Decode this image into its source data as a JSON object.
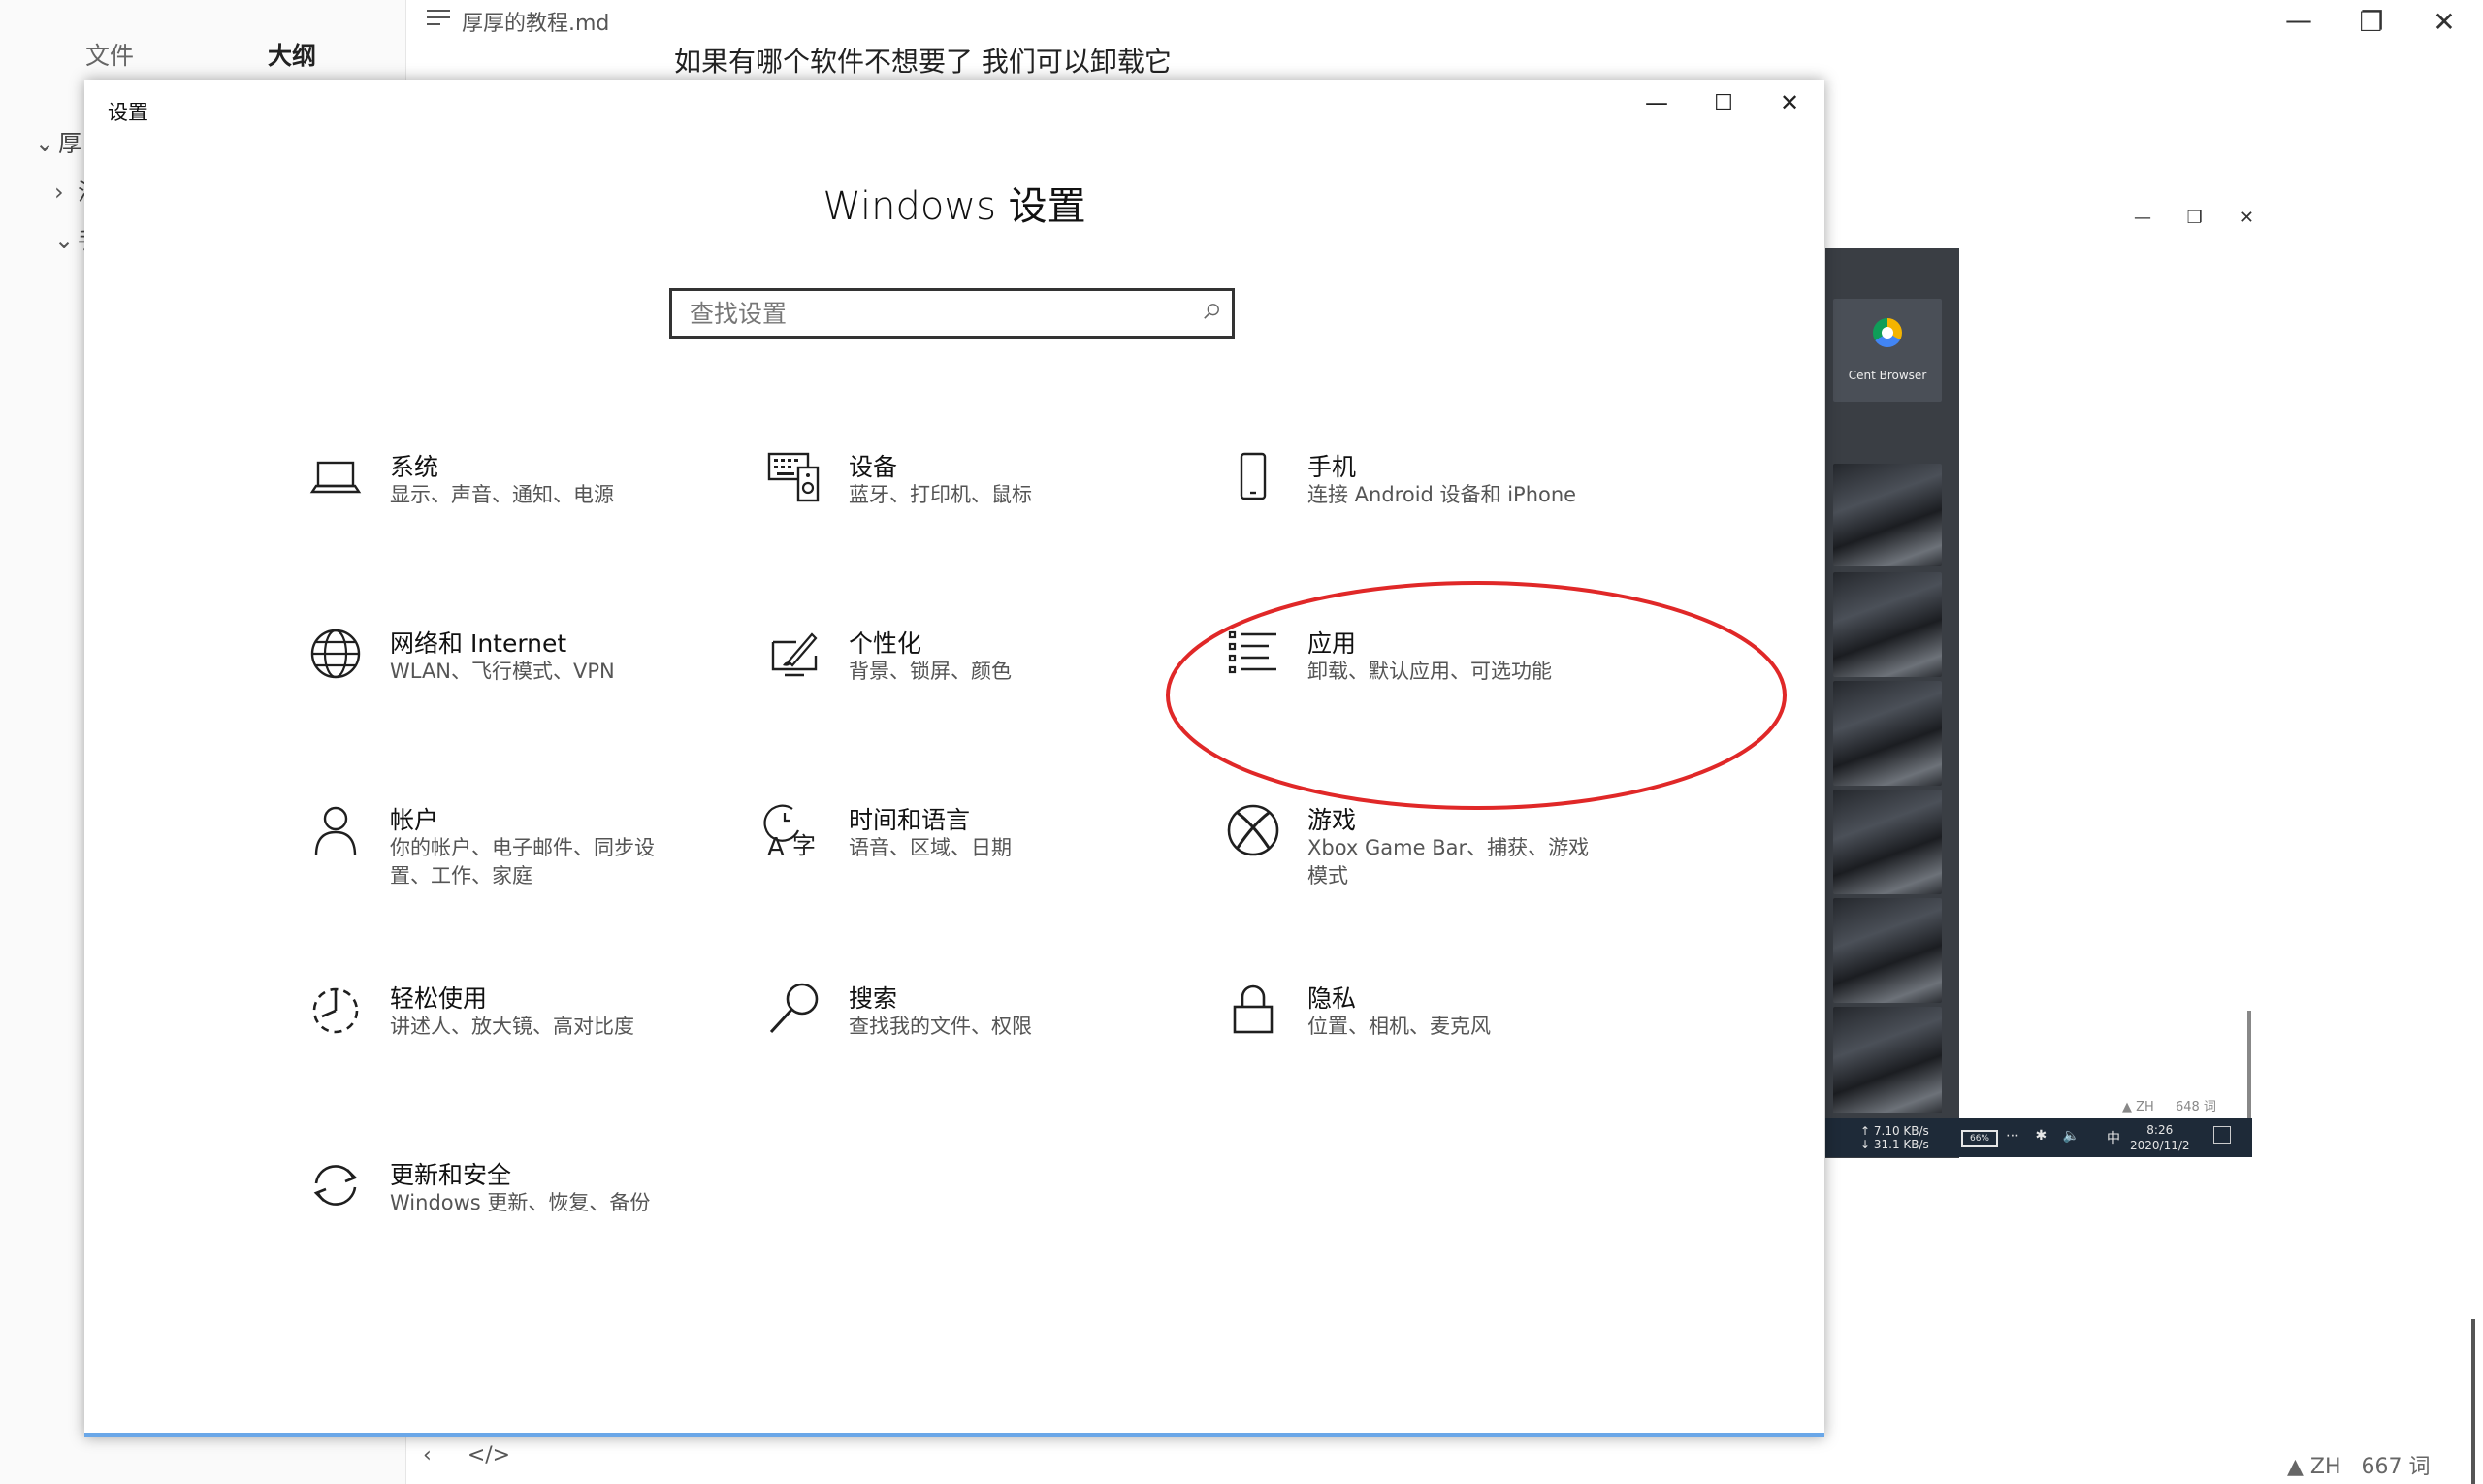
{
  "typora": {
    "tab_file": "文件",
    "tab_outline": "大纲",
    "outline_rows": [
      {
        "chevron": "⌄",
        "text": "厚"
      },
      {
        "chevron": "›",
        "text": "注"
      },
      {
        "chevron": "⌄",
        "text": "手"
      }
    ],
    "file_title": "厚厚的教程.md",
    "doc_line": "如果有哪个软件不想要了  我们可以卸载它",
    "min": "—",
    "max": "❐",
    "close": "✕",
    "bottom_left": [
      "‹",
      "</>"
    ],
    "status_warn": "▲ ZH",
    "word_count": "667 词"
  },
  "mirror": {
    "controls": [
      "—",
      "❐",
      "✕"
    ],
    "app_label": "Cent Browser",
    "status_warn": "▲ ZH",
    "word_count": "648 词",
    "speed_up": "↑ 7.10 KB/s",
    "speed_down": "↓ 31.1 KB/s",
    "battery": "66%",
    "tray_icons": "⋯ ✱ 🔈",
    "ime": "中",
    "time": "8:26",
    "date": "2020/11/2"
  },
  "settings": {
    "window_title": "设置",
    "min": "—",
    "max": "☐",
    "close": "✕",
    "heading": "Windows 设置",
    "search_placeholder": "查找设置",
    "tiles": [
      {
        "icon": "laptop-icon",
        "name": "系统",
        "desc": "显示、声音、通知、电源"
      },
      {
        "icon": "keyboard-speaker-icon",
        "name": "设备",
        "desc": "蓝牙、打印机、鼠标"
      },
      {
        "icon": "phone-icon",
        "name": "手机",
        "desc": "连接 Android 设备和 iPhone"
      },
      {
        "icon": "globe-icon",
        "name": "网络和 Internet",
        "desc": "WLAN、飞行模式、VPN"
      },
      {
        "icon": "brush-icon",
        "name": "个性化",
        "desc": "背景、锁屏、颜色"
      },
      {
        "icon": "apps-list-icon",
        "name": "应用",
        "desc": "卸载、默认应用、可选功能"
      },
      {
        "icon": "person-icon",
        "name": "帐户",
        "desc": "你的帐户、电子邮件、同步设置、工作、家庭"
      },
      {
        "icon": "time-language-icon",
        "name": "时间和语言",
        "desc": "语音、区域、日期"
      },
      {
        "icon": "xbox-icon",
        "name": "游戏",
        "desc": "Xbox Game Bar、捕获、游戏模式"
      },
      {
        "icon": "ease-of-access-icon",
        "name": "轻松使用",
        "desc": "讲述人、放大镜、高对比度"
      },
      {
        "icon": "search-icon",
        "name": "搜索",
        "desc": "查找我的文件、权限"
      },
      {
        "icon": "lock-icon",
        "name": "隐私",
        "desc": "位置、相机、麦克风"
      },
      {
        "icon": "sync-icon",
        "name": "更新和安全",
        "desc": "Windows 更新、恢复、备份"
      }
    ]
  },
  "colors": {
    "annotation": "#e02828",
    "accent": "#6aa7e8",
    "icon": "#1f1f1f"
  }
}
